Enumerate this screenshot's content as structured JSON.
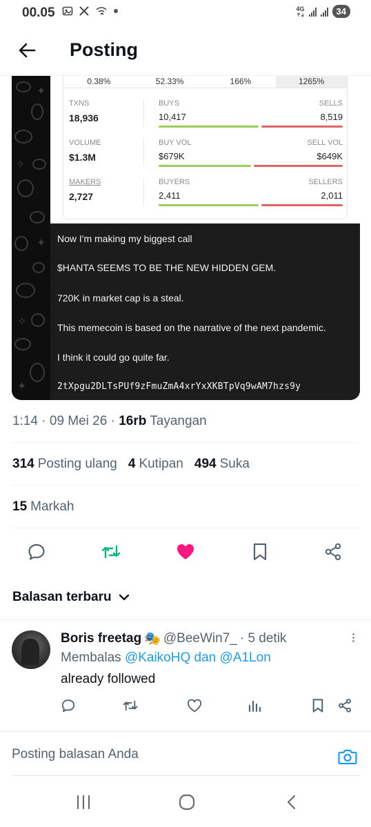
{
  "status_bar": {
    "time": "00.05",
    "network": "4G",
    "battery": "34",
    "icons": [
      "gallery-icon",
      "x-icon",
      "wifi-sync-icon",
      "dot-icon",
      "signal-icon",
      "signal-icon"
    ]
  },
  "header": {
    "title": "Posting"
  },
  "media": {
    "percent_row": [
      "0.38%",
      "52.33%",
      "166%",
      "1265%"
    ],
    "rows": [
      {
        "label": "TXNS",
        "value": "18,936",
        "left_label": "BUYS",
        "left_value": "10,417",
        "right_label": "SELLS",
        "right_value": "8,519",
        "buy_share": 0.55
      },
      {
        "label": "VOLUME",
        "value": "$1.3M",
        "left_label": "BUY VOL",
        "left_value": "$679K",
        "right_label": "SELL VOL",
        "right_value": "$649K",
        "buy_share": 0.51
      },
      {
        "label": "MAKERS",
        "value": "2,727",
        "left_label": "BUYERS",
        "left_value": "2,411",
        "right_label": "SELLERS",
        "right_value": "2,011",
        "buy_share": 0.55
      }
    ],
    "text_lines": [
      "Now I'm making my biggest call",
      "$HANTA SEEMS TO BE THE NEW HIDDEN GEM.",
      "720K in market cap is a steal.",
      "This memecoin is based on the narrative of the next pandemic.",
      "I think it could go quite far.",
      "2tXpgu2DLTsPUf9zFmuZmA4xrYxXKBTpVq9wAM7hzs9y"
    ]
  },
  "meta": {
    "time": "1:14",
    "date": "09 Mei 26",
    "views": "16rb",
    "views_label": "Tayangan"
  },
  "counts": {
    "reposts": "314",
    "reposts_label": "Posting ulang",
    "quotes": "4",
    "quotes_label": "Kutipan",
    "likes": "494",
    "likes_label": "Suka",
    "bookmarks": "15",
    "bookmarks_label": "Markah"
  },
  "actions": [
    "reply-icon",
    "repost-icon",
    "like-icon",
    "bookmark-icon",
    "share-icon"
  ],
  "colors": {
    "repost": "#00ba7c",
    "like": "#f91880",
    "link": "#1d9bf0",
    "muted": "#536471"
  },
  "replies": {
    "sort_label": "Balasan terbaru",
    "items": [
      {
        "name": "Boris freetag",
        "emoji": "🎭",
        "handle": "@BeeWin7_",
        "time": "· 5 detik",
        "replying_prefix": "Membalas",
        "replying_to_1": "@KaikoHQ",
        "replying_join": "dan",
        "replying_to_2": "@A1Lon",
        "text": "already followed"
      }
    ]
  },
  "compose": {
    "placeholder": "Posting balasan Anda"
  }
}
